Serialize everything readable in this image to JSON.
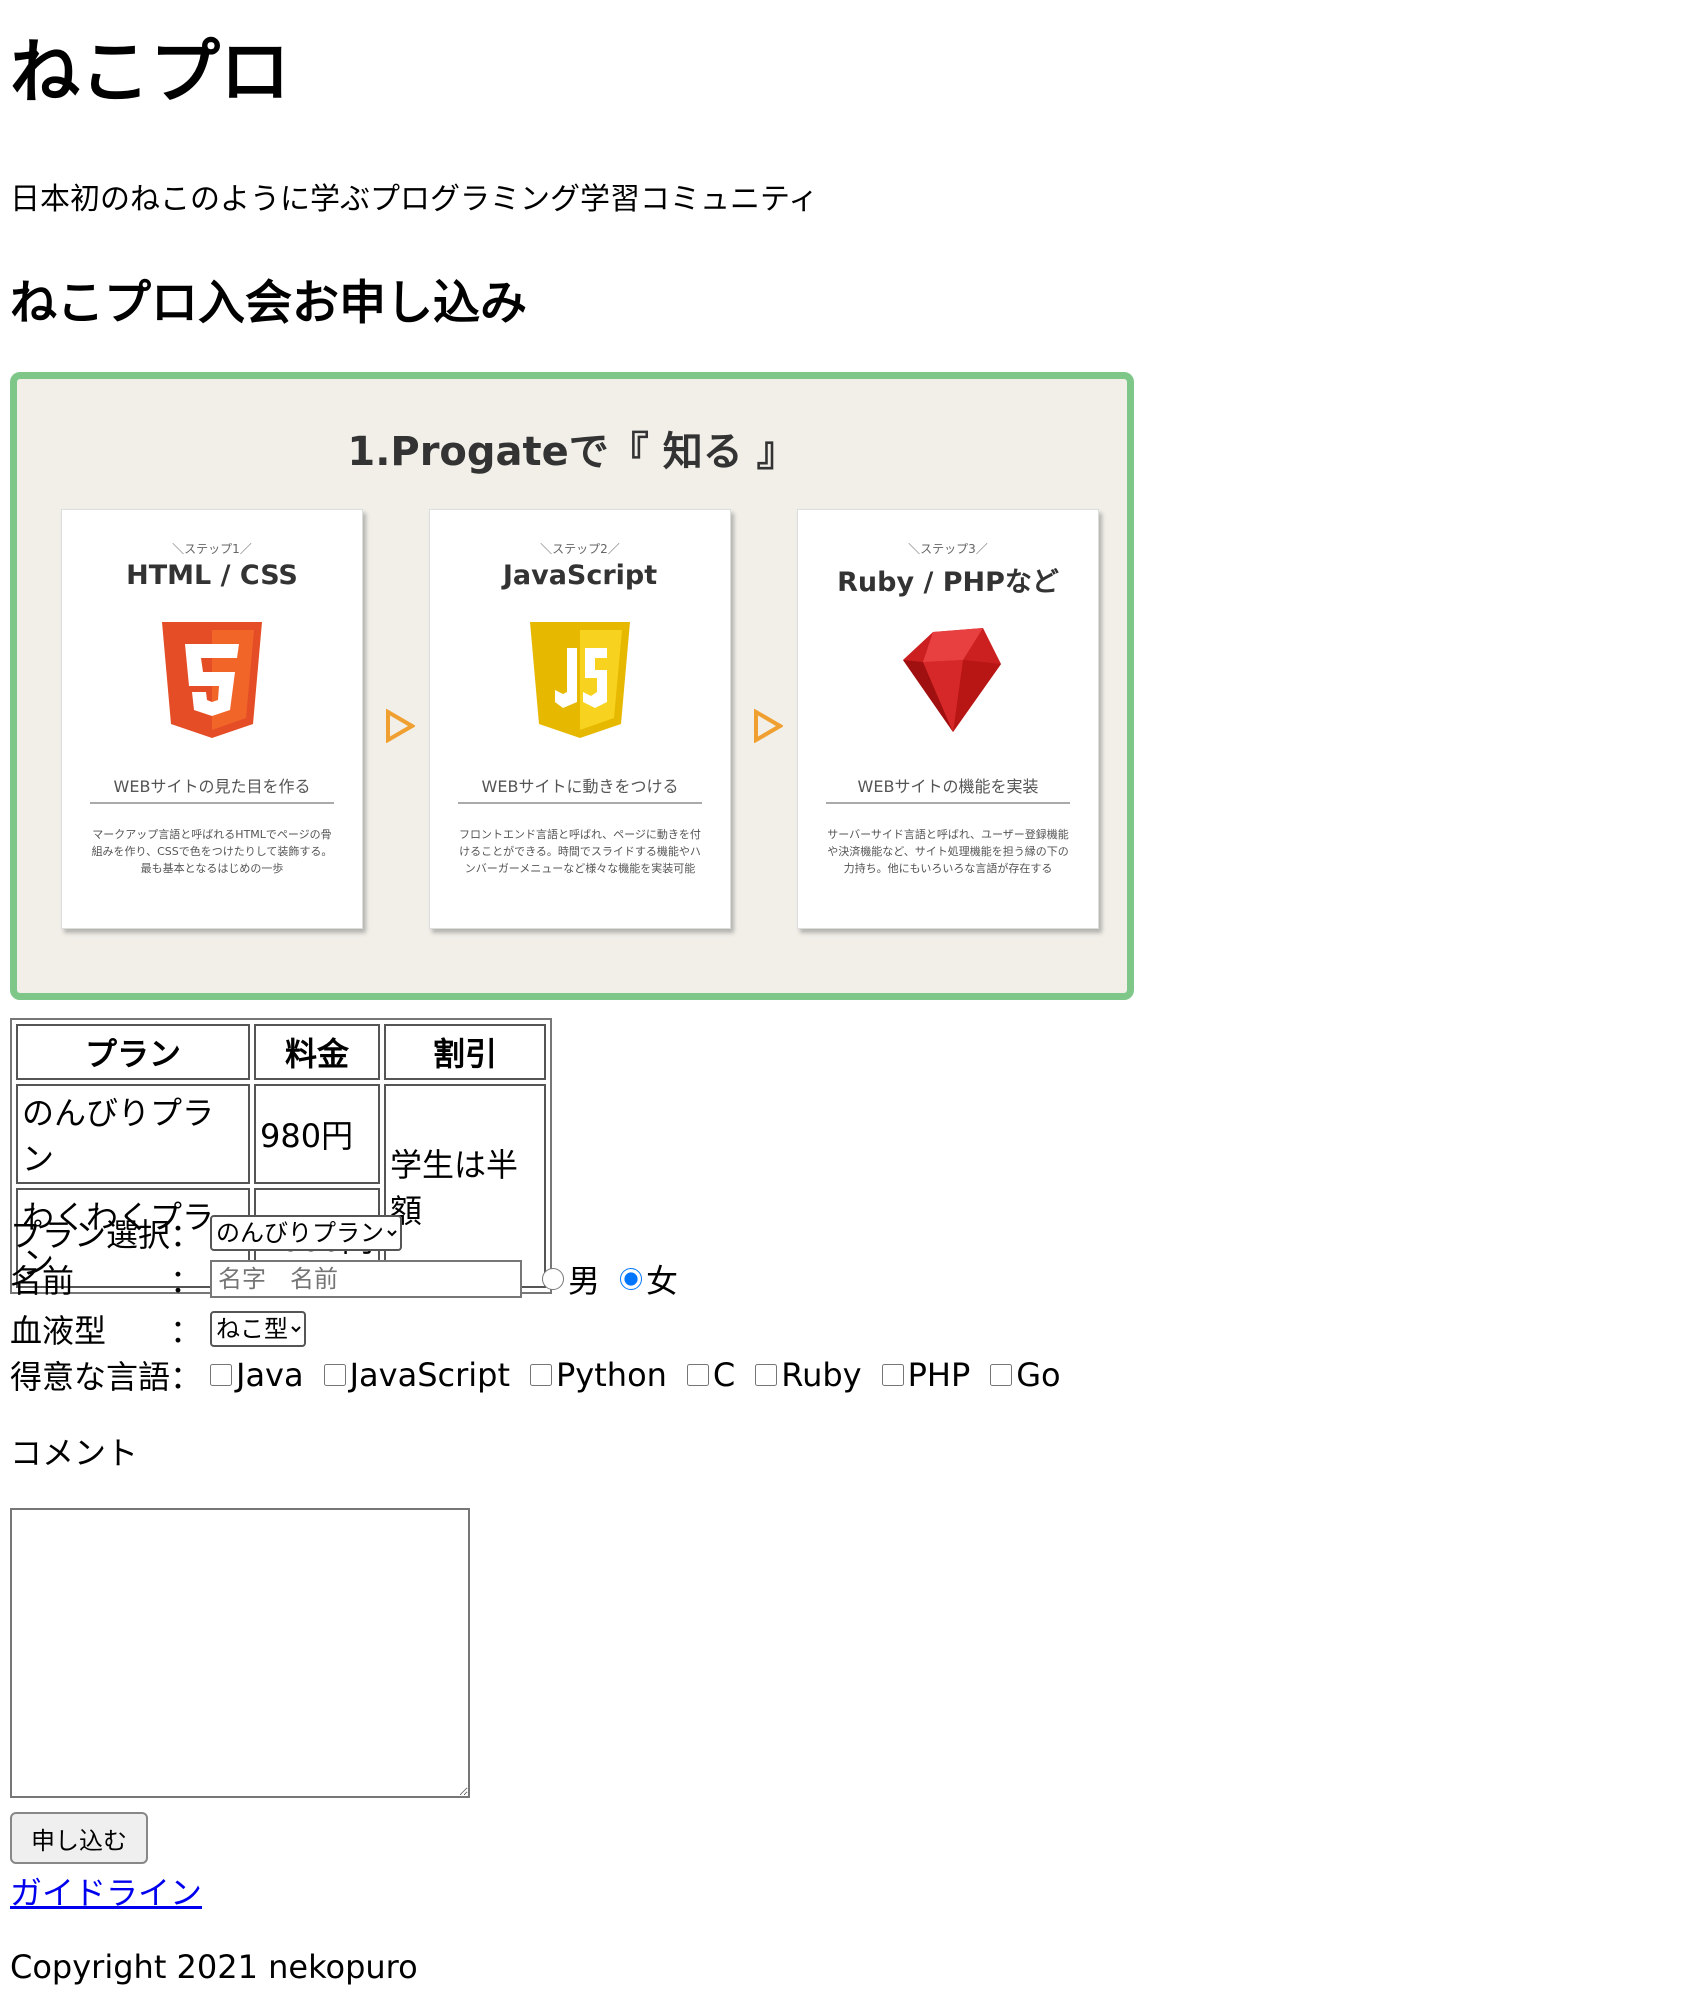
{
  "header": {
    "title": "ねこプロ",
    "tagline": "日本初のねこのように学ぶプログラミング学習コミュニティ",
    "subtitle": "ねこプロ入会お申し込み"
  },
  "banner": {
    "title": "1.Progateで『 知る 』",
    "cards": [
      {
        "step": "＼ステップ1／",
        "name": "HTML / CSS",
        "logo": "html5-logo",
        "subtitle": "WEBサイトの見た目を作る",
        "desc": "マークアップ言語と呼ばれるHTMLでページの骨組みを作り、CSSで色をつけたりして装飾する。最も基本となるはじめの一歩"
      },
      {
        "step": "＼ステップ2／",
        "name": "JavaScript",
        "logo": "js-logo",
        "subtitle": "WEBサイトに動きをつける",
        "desc": "フロントエンド言語と呼ばれ、ページに動きを付けることができる。時間でスライドする機能やハンバーガーメニューなど様々な機能を実装可能"
      },
      {
        "step": "＼ステップ3／",
        "name": "Ruby / PHPなど",
        "logo": "ruby-gem-logo",
        "subtitle": "WEBサイトの機能を実装",
        "desc": "サーバーサイド言語と呼ばれ、ユーザー登録機能や決済機能など、サイト処理機能を担う縁の下の力持ち。他にもいろいろな言語が存在する"
      }
    ]
  },
  "plan_table": {
    "headers": [
      "プラン",
      "料金",
      "割引"
    ],
    "rows": [
      {
        "plan": "のんびりプラン",
        "price": "980円"
      },
      {
        "plan": "わくわくプラン",
        "price": "2000円"
      }
    ],
    "discount": "学生は半額"
  },
  "form": {
    "plan_label": "プラン選択",
    "plan_selected": "のんびりプラン",
    "name_label": "名前",
    "name_placeholder": "名字　名前",
    "gender_options": [
      "男",
      "女"
    ],
    "gender_selected": "女",
    "blood_label": "血液型",
    "blood_selected": "ねこ型",
    "languages_label": "得意な言語",
    "languages": [
      "Java",
      "JavaScript",
      "Python",
      "C",
      "Ruby",
      "PHP",
      "Go"
    ],
    "colon": "：",
    "comment_label": "コメント",
    "submit_label": "申し込む"
  },
  "footer": {
    "guideline_link": "ガイドライン",
    "copyright": "Copyright 2021 nekopuro"
  },
  "colors": {
    "banner_border": "#7fc788",
    "link": "#0000ee",
    "radio_selected": "#1a73e8"
  }
}
